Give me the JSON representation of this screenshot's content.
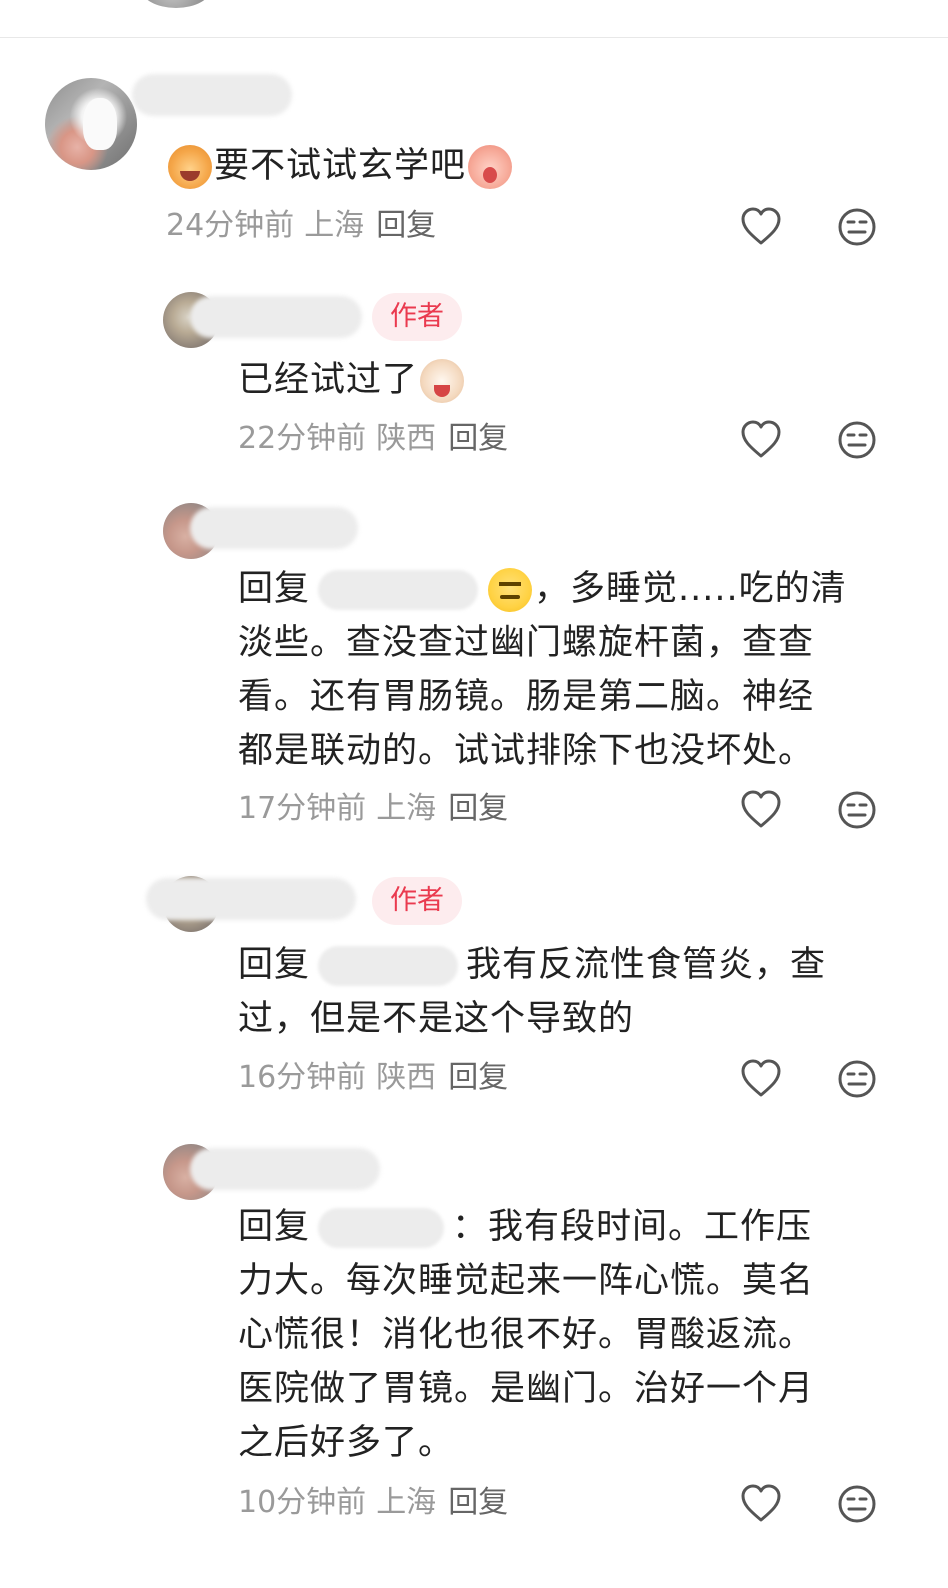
{
  "author_tag": "作者",
  "reply_prefix": "回复",
  "comments": [
    {
      "text_before": "要不试试玄学吧",
      "emoji_left": "laughing-cat-emoji",
      "emoji_right": "crying-baby-emoji",
      "time": "24分钟前",
      "location": "上海",
      "reply": "回复"
    },
    {
      "text": "已经试过了",
      "emoji_right": "crying-dog-emoji",
      "time": "22分钟前",
      "location": "陕西",
      "reply": "回复"
    },
    {
      "line1_after": "，多睡觉.....吃的清",
      "line2": "淡些。查没查过幽门螺旋杆菌，查查",
      "line3": "看。还有胃肠镜。肠是第二脑。神经",
      "line4": "都是联动的。试试排除下也没坏处。",
      "emoji": "neutral-face-emoji",
      "time": "17分钟前",
      "location": "上海",
      "reply": "回复"
    },
    {
      "line1_after": "我有反流性食管炎，查",
      "line2": "过，但是不是这个导致的",
      "time": "16分钟前",
      "location": "陕西",
      "reply": "回复"
    },
    {
      "line1_after": "：我有段时间。工作压",
      "line2": "力大。每次睡觉起来一阵心慌。莫名",
      "line3": "心慌很！消化也很不好。胃酸返流。",
      "line4": "医院做了胃镜。是幽门。治好一个月",
      "line5": "之后好多了。",
      "time": "10分钟前",
      "location": "上海",
      "reply": "回复"
    }
  ],
  "colors": {
    "author_tag_bg": "#fdecee",
    "author_tag_text": "#ea3a4f",
    "meta_text": "#9a9a9a",
    "icon_stroke": "#555555"
  },
  "icons": [
    "heart-icon",
    "dislike-face-icon"
  ]
}
